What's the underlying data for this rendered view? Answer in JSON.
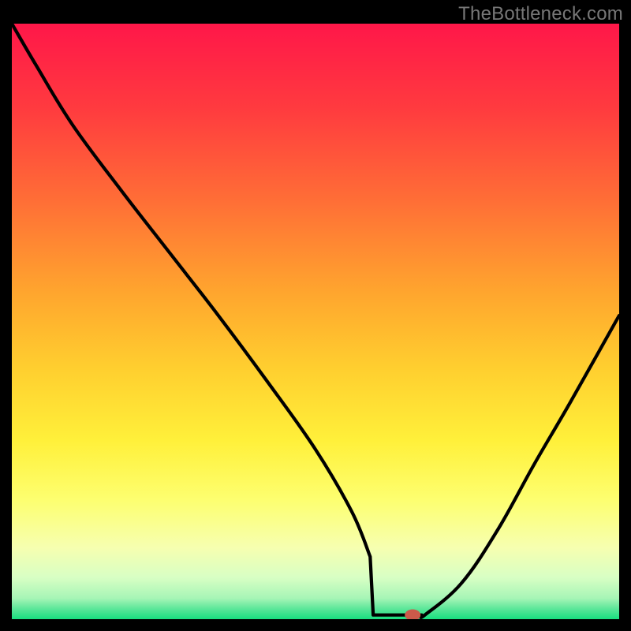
{
  "watermark": "TheBottleneck.com",
  "colors": {
    "marker": "#cc5a4a",
    "curve": "#000000",
    "grad_top": "#ff1749",
    "grad_bottom": "#18df7f"
  },
  "chart_data": {
    "type": "line",
    "title": "",
    "xlabel": "",
    "ylabel": "",
    "xlim": [
      0,
      100
    ],
    "ylim": [
      0,
      100
    ],
    "x": [
      0,
      4,
      10,
      18,
      26,
      34,
      42,
      50,
      56,
      59,
      62,
      65,
      68,
      74,
      80,
      86,
      92,
      100
    ],
    "y": [
      100,
      93,
      83,
      72,
      61.5,
      51,
      40,
      28.5,
      18,
      10.5,
      4.5,
      0.7,
      0.7,
      6,
      15,
      26,
      36.5,
      51
    ],
    "marker_x": 66,
    "marker_y": 0.7,
    "flat_segment": {
      "x0": 59.5,
      "x1": 67.5,
      "y": 0.7
    }
  }
}
